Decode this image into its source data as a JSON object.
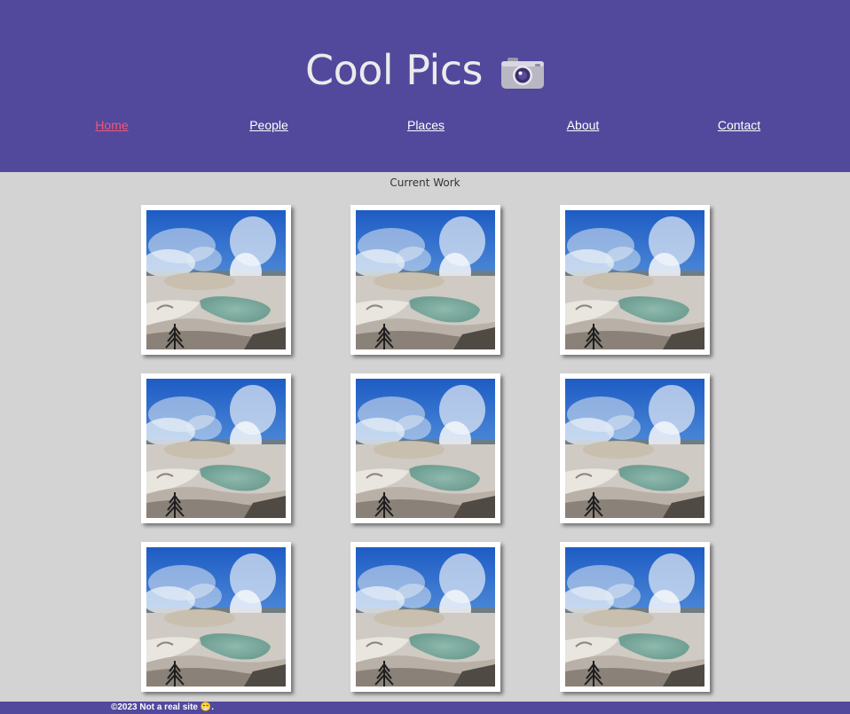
{
  "header": {
    "title": "Cool Pics",
    "camera_icon": "camera-icon",
    "background_color": "#52489c"
  },
  "nav": {
    "items": [
      {
        "label": "Home",
        "active": true
      },
      {
        "label": "People",
        "active": false
      },
      {
        "label": "Places",
        "active": false
      },
      {
        "label": "About",
        "active": false
      },
      {
        "label": "Contact",
        "active": false
      }
    ],
    "active_color": "#f0577a"
  },
  "main": {
    "section_title": "Current Work",
    "photos": [
      {
        "image": "geyser-photo"
      },
      {
        "image": "geyser-photo"
      },
      {
        "image": "geyser-photo"
      },
      {
        "image": "geyser-photo"
      },
      {
        "image": "geyser-photo"
      },
      {
        "image": "geyser-photo"
      },
      {
        "image": "geyser-photo"
      },
      {
        "image": "geyser-photo"
      },
      {
        "image": "geyser-photo"
      }
    ]
  },
  "footer": {
    "text": "©2023 Not a real site 😁."
  }
}
